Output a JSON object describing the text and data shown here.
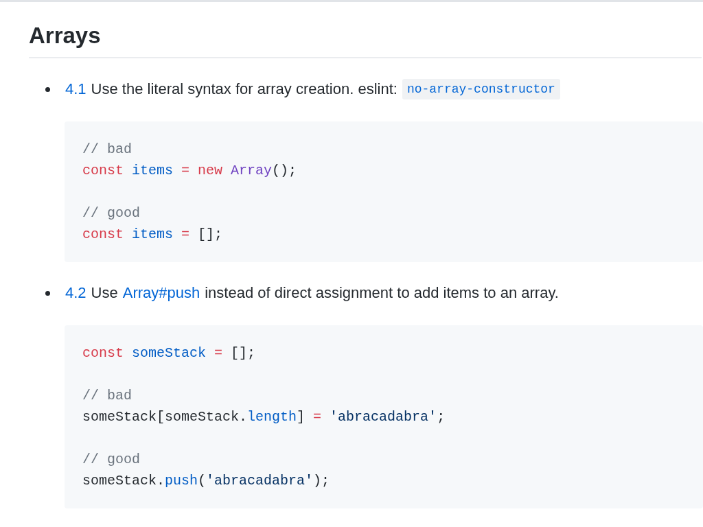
{
  "heading": "Arrays",
  "items": [
    {
      "number": "4.1",
      "parts": [
        {
          "kind": "text",
          "text": "Use the literal syntax for array creation. eslint:"
        },
        {
          "kind": "code",
          "text": "no-array-constructor"
        }
      ],
      "code": [
        [
          [
            {
              "kind": "comment",
              "text": "// bad"
            }
          ],
          [
            {
              "kind": "keyword",
              "text": "const"
            },
            {
              "kind": "variable",
              "text": " items"
            },
            {
              "kind": "keyword",
              "text": " ="
            },
            {
              "kind": "keyword",
              "text": " new"
            },
            {
              "kind": "class",
              "text": " Array"
            },
            {
              "kind": "plain",
              "text": "();"
            }
          ]
        ],
        [
          [
            {
              "kind": "comment",
              "text": "// good"
            }
          ],
          [
            {
              "kind": "keyword",
              "text": "const"
            },
            {
              "kind": "variable",
              "text": " items"
            },
            {
              "kind": "keyword",
              "text": " ="
            },
            {
              "kind": "plain",
              "text": " [];"
            }
          ]
        ]
      ]
    },
    {
      "number": "4.2",
      "parts": [
        {
          "kind": "text",
          "text": "Use"
        },
        {
          "kind": "link",
          "text": "Array#push"
        },
        {
          "kind": "text",
          "text": "instead of direct assignment to add items to an array."
        }
      ],
      "code": [
        [
          [
            {
              "kind": "keyword",
              "text": "const"
            },
            {
              "kind": "variable",
              "text": " someStack"
            },
            {
              "kind": "keyword",
              "text": " ="
            },
            {
              "kind": "plain",
              "text": " [];"
            }
          ]
        ],
        [
          [
            {
              "kind": "comment",
              "text": "// bad"
            }
          ],
          [
            {
              "kind": "plain",
              "text": "someStack[someStack."
            },
            {
              "kind": "variable",
              "text": "length"
            },
            {
              "kind": "plain",
              "text": "]"
            },
            {
              "kind": "keyword",
              "text": " ="
            },
            {
              "kind": "string",
              "text": " 'abracadabra'"
            },
            {
              "kind": "plain",
              "text": ";"
            }
          ]
        ],
        [
          [
            {
              "kind": "comment",
              "text": "// good"
            }
          ],
          [
            {
              "kind": "plain",
              "text": "someStack."
            },
            {
              "kind": "variable",
              "text": "push"
            },
            {
              "kind": "plain",
              "text": "("
            },
            {
              "kind": "string",
              "text": "'abracadabra'"
            },
            {
              "kind": "plain",
              "text": ");"
            }
          ]
        ]
      ]
    }
  ]
}
